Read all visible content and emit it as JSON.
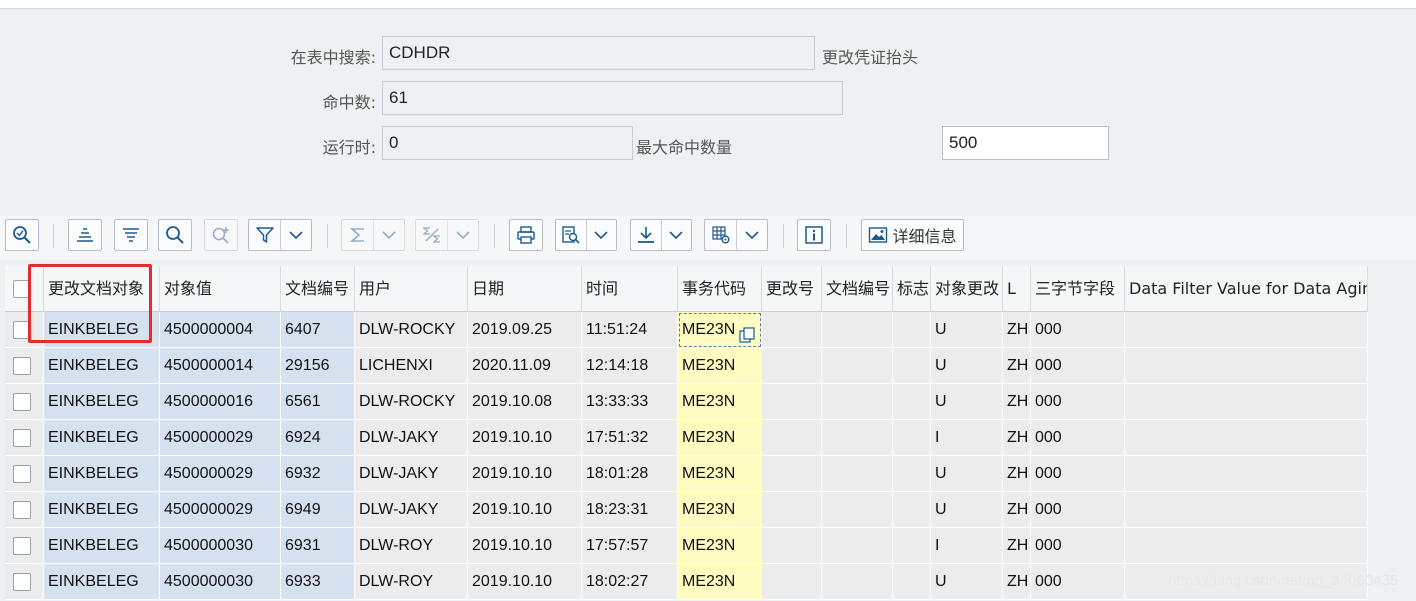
{
  "form": {
    "search_label": "在表中搜索:",
    "search_value": "CDHDR",
    "search_desc": "更改凭证抬头",
    "hits_label": "命中数:",
    "hits_value": "61",
    "runtime_label": "运行时:",
    "runtime_value": "0",
    "maxhits_label": "最大命中数量",
    "maxhits_value": "500"
  },
  "toolbar": {
    "detail_label": "详细信息",
    "icons": [
      "details-zoom-icon",
      "sort-ascending-icon",
      "sort-descending-icon",
      "search-icon",
      "search-next-icon",
      "filter-icon",
      "sum-icon",
      "subtotal-icon",
      "print-icon",
      "view-icon",
      "export-icon",
      "layout-icon",
      "info-icon",
      "picture-icon"
    ]
  },
  "table": {
    "headers": [
      "更改文档对象",
      "对象值",
      "文档编号",
      "用户",
      "日期",
      "时间",
      "事务代码",
      "更改号",
      "文档编号",
      "标志",
      "对象更改",
      "L",
      "三字节字段",
      "Data Filter Value for Data Aging"
    ],
    "rows": [
      [
        "EINKBELEG",
        "4500000004",
        "6407",
        "DLW-ROCKY",
        "2019.09.25",
        "11:51:24",
        "ME23N",
        "",
        "",
        "",
        "U",
        "ZH",
        "000",
        ""
      ],
      [
        "EINKBELEG",
        "4500000014",
        "29156",
        "LICHENXI",
        "2020.11.09",
        "12:14:18",
        "ME23N",
        "",
        "",
        "",
        "U",
        "ZH",
        "000",
        ""
      ],
      [
        "EINKBELEG",
        "4500000016",
        "6561",
        "DLW-ROCKY",
        "2019.10.08",
        "13:33:33",
        "ME23N",
        "",
        "",
        "",
        "U",
        "ZH",
        "000",
        ""
      ],
      [
        "EINKBELEG",
        "4500000029",
        "6924",
        "DLW-JAKY",
        "2019.10.10",
        "17:51:32",
        "ME23N",
        "",
        "",
        "",
        "I",
        "ZH",
        "000",
        ""
      ],
      [
        "EINKBELEG",
        "4500000029",
        "6932",
        "DLW-JAKY",
        "2019.10.10",
        "18:01:28",
        "ME23N",
        "",
        "",
        "",
        "U",
        "ZH",
        "000",
        ""
      ],
      [
        "EINKBELEG",
        "4500000029",
        "6949",
        "DLW-JAKY",
        "2019.10.10",
        "18:23:31",
        "ME23N",
        "",
        "",
        "",
        "U",
        "ZH",
        "000",
        ""
      ],
      [
        "EINKBELEG",
        "4500000030",
        "6931",
        "DLW-ROY",
        "2019.10.10",
        "17:57:57",
        "ME23N",
        "",
        "",
        "",
        "I",
        "ZH",
        "000",
        ""
      ],
      [
        "EINKBELEG",
        "4500000030",
        "6933",
        "DLW-ROY",
        "2019.10.10",
        "18:02:27",
        "ME23N",
        "",
        "",
        "",
        "U",
        "ZH",
        "000",
        ""
      ]
    ]
  },
  "colors": {
    "key_column": "#d5e1ee",
    "plain_column": "#ececec",
    "tcode_column": "#fefcc0",
    "highlight_box": "#e32c2c"
  },
  "watermark": "https://blog.csdn.net/qq_34060435"
}
